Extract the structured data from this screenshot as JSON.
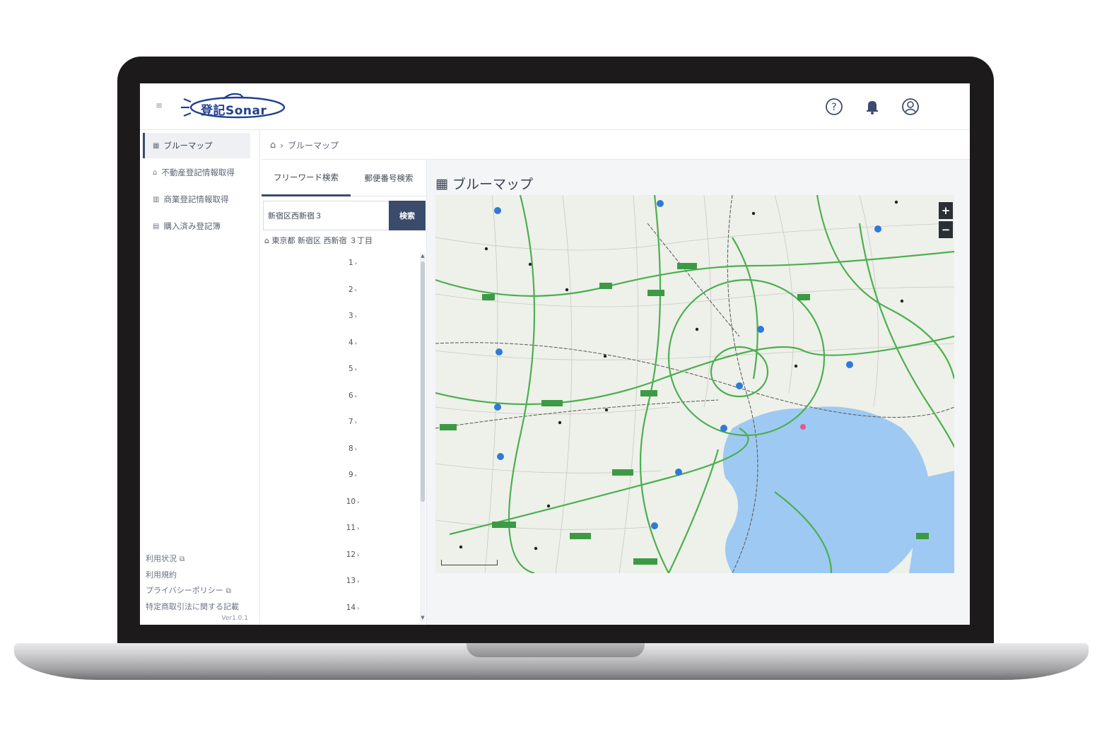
{
  "app": {
    "logo_text": "登記Sonar",
    "menu_toggle": "≡"
  },
  "header": {
    "help_icon": "question-circle-icon",
    "bell_icon": "bell-icon",
    "user_icon": "user-circle-icon"
  },
  "sidebar": {
    "items": [
      {
        "label": "ブルーマップ",
        "icon": "map-icon",
        "active": true
      },
      {
        "label": "不動産登記情報取得",
        "icon": "house-icon",
        "active": false
      },
      {
        "label": "商業登記情報取得",
        "icon": "building-icon",
        "active": false
      },
      {
        "label": "購入済み登記簿",
        "icon": "document-icon",
        "active": false
      }
    ],
    "footer_links": [
      {
        "label": "利用状況",
        "external": true
      },
      {
        "label": "利用規約",
        "external": false
      },
      {
        "label": "プライバシーポリシー",
        "external": true
      },
      {
        "label": "特定商取引法に関する記載",
        "external": false
      }
    ],
    "version": "Ver1.0.1"
  },
  "breadcrumb": {
    "home_icon": "home-icon",
    "current": "ブルーマップ"
  },
  "search": {
    "tabs": [
      "フリーワード検索",
      "郵便番号検索"
    ],
    "active_tab": 0,
    "input_value": "新宿区西新宿３",
    "button_label": "検索",
    "address": "東京都 新宿区 西新宿 ３丁目",
    "lots": [
      "1",
      "2",
      "3",
      "4",
      "5",
      "6",
      "7",
      "8",
      "9",
      "10",
      "11",
      "12",
      "13",
      "14"
    ]
  },
  "map": {
    "title": "ブルーマップ",
    "zoom_in": "+",
    "zoom_out": "−",
    "water_color": "#9ec9f2",
    "road_color": "#4caf50"
  }
}
